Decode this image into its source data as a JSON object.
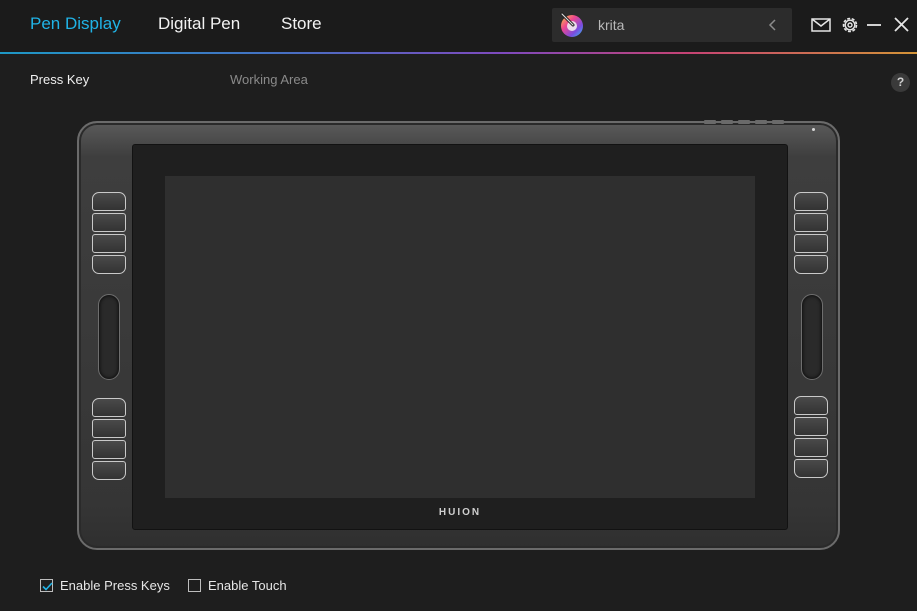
{
  "header": {
    "tabs": [
      {
        "label": "Pen Display",
        "active": true
      },
      {
        "label": "Digital Pen",
        "active": false
      },
      {
        "label": "Store",
        "active": false
      }
    ],
    "app_selector": {
      "value": "krita",
      "logo_icon": "krita-logo-icon",
      "toggle_icon": "chevron-left-icon"
    },
    "window_icons": [
      "mail-icon",
      "gear-icon",
      "minimize-icon",
      "close-icon"
    ],
    "accent_color": "#20b3e6"
  },
  "subtabs": {
    "press_key": "Press Key",
    "working_area": "Working Area",
    "help": "?"
  },
  "tablet": {
    "brand": "HUION"
  },
  "options": {
    "enable_press_keys": {
      "label": "Enable Press Keys",
      "checked": true
    },
    "enable_touch": {
      "label": "Enable Touch",
      "checked": false
    }
  }
}
